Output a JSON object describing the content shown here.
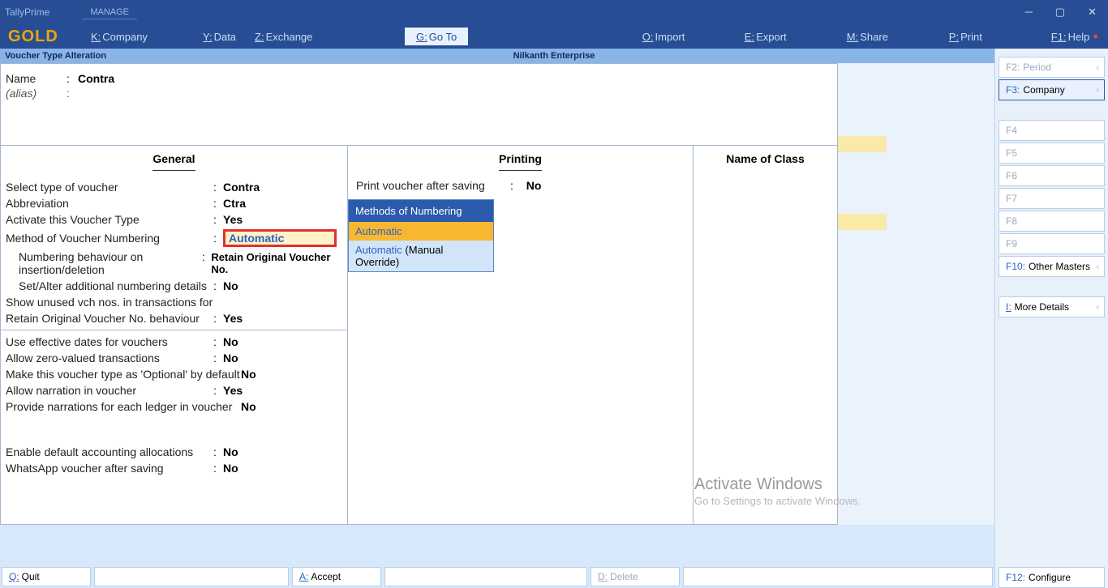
{
  "app": {
    "name": "TallyPrime",
    "edition": "GOLD",
    "manage": "MANAGE"
  },
  "menu": {
    "company": "Company",
    "company_k": "K:",
    "data": "Data",
    "data_k": "Y:",
    "exchange": "Exchange",
    "exchange_k": "Z:",
    "goto": "Go To",
    "goto_k": "G:",
    "import": "Import",
    "import_k": "O:",
    "export": "Export",
    "export_k": "E:",
    "share": "Share",
    "share_k": "M:",
    "print": "Print",
    "print_k": "P:",
    "help": "Help",
    "help_k": "F1:"
  },
  "subheader": {
    "left": "Voucher Type Alteration",
    "center": "Nilkanth Enterprise"
  },
  "name_block": {
    "name_label": "Name",
    "name_value": "Contra",
    "alias_label": "(alias)"
  },
  "columns": {
    "general": "General",
    "printing": "Printing",
    "name_of_class": "Name of Class"
  },
  "general_fields": {
    "type_label": "Select type of voucher",
    "type_val": "Contra",
    "abbr_label": "Abbreviation",
    "abbr_val": "Ctra",
    "activate_label": "Activate this Voucher Type",
    "activate_val": "Yes",
    "method_label": "Method of Voucher Numbering",
    "method_val": "Automatic",
    "numb_behav_label": "Numbering behaviour on insertion/deletion",
    "numb_behav_val": "Retain Original Voucher No.",
    "set_alter_label": "Set/Alter additional numbering details",
    "set_alter_val": "No",
    "show_unused_label1": "Show unused vch nos. in transactions for",
    "show_unused_label2": "Retain Original Voucher No. behaviour",
    "show_unused_val": "Yes",
    "eff_dates_label": "Use effective dates for vouchers",
    "eff_dates_val": "No",
    "zero_val_label": "Allow zero-valued transactions",
    "zero_val_val": "No",
    "optional_label": "Make this voucher type as 'Optional' by default",
    "optional_val": "No",
    "narration_label": "Allow narration in voucher",
    "narration_val": "Yes",
    "ledger_narr_label": "Provide narrations for each ledger in voucher",
    "ledger_narr_val": "No",
    "enable_alloc_label": "Enable default accounting allocations",
    "enable_alloc_val": "No",
    "whatsapp_label": "WhatsApp voucher after saving",
    "whatsapp_val": "No"
  },
  "printing_fields": {
    "print_after_label": "Print voucher after saving",
    "print_after_val": "No"
  },
  "dropdown": {
    "title": "Methods of Numbering",
    "opt1": "Automatic",
    "opt2a": "Automatic",
    "opt2b": " (Manual Override)"
  },
  "rhs": {
    "f2": "Period",
    "f2k": "F2:",
    "f3": "Company",
    "f3k": "F3:",
    "f4": "F4",
    "f5": "F5",
    "f6": "F6",
    "f7": "F7",
    "f8": "F8",
    "f9": "F9",
    "f10": "Other Masters",
    "f10k": "F10:",
    "more_k": "I:",
    "more": "More Details",
    "f12": "Configure",
    "f12k": "F12:"
  },
  "bottom": {
    "quit_k": "Q:",
    "quit": "Quit",
    "accept_k": "A:",
    "accept": "Accept",
    "delete_k": "D:",
    "delete": "Delete"
  },
  "watermark": {
    "big": "Activate Windows",
    "small": "Go to Settings to activate Windows."
  }
}
